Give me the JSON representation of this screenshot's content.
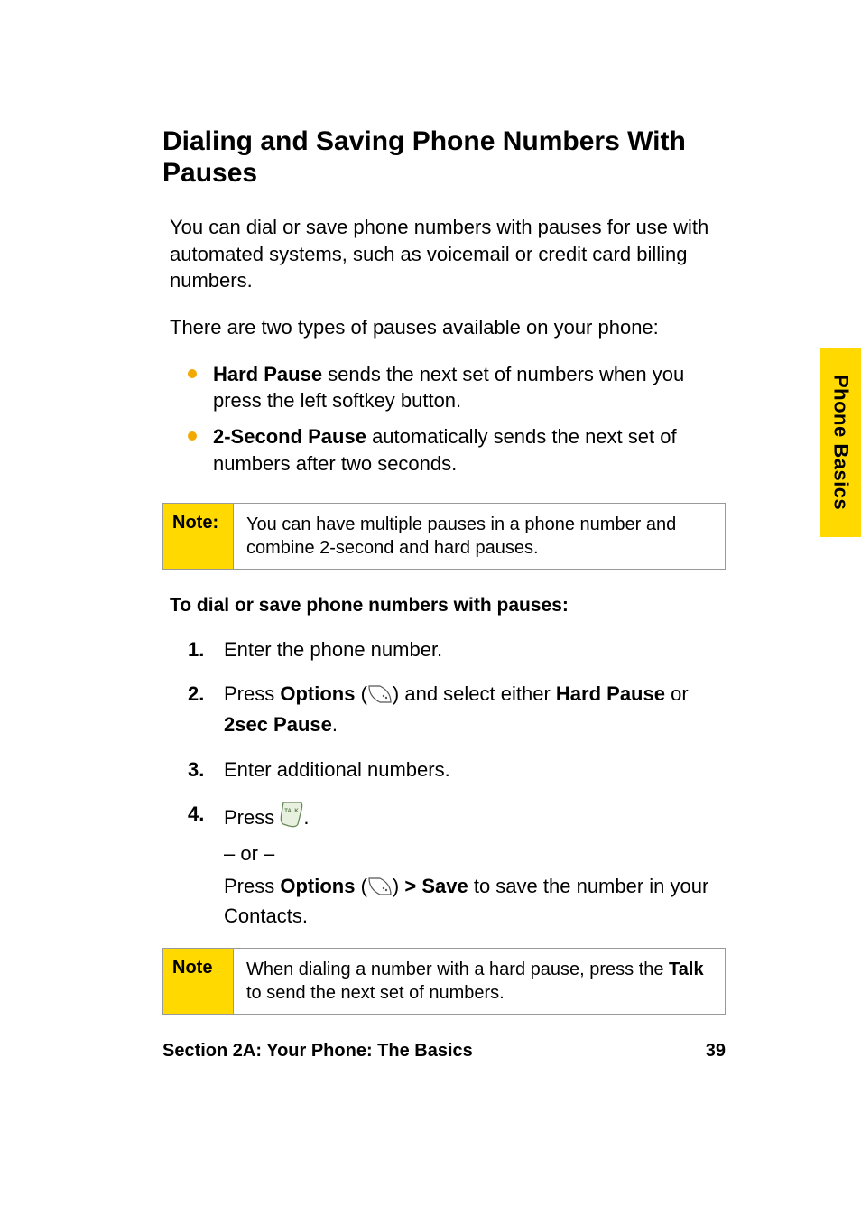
{
  "sideTab": "Phone Basics",
  "heading": "Dialing and Saving Phone Numbers With Pauses",
  "intro1": "You can dial or save phone numbers with pauses for use with automated systems, such as voicemail or credit card billing numbers.",
  "intro2": "There are two types of pauses available on your phone:",
  "bullets": [
    {
      "boldLead": "Hard Pause",
      "rest": " sends the next set of numbers when you press the left softkey button."
    },
    {
      "boldLead": "2-Second Pause",
      "rest": " automatically sends the next set of numbers after two seconds."
    }
  ],
  "note1": {
    "label": "Note:",
    "text": "You can have multiple pauses in a phone number and combine 2-second and hard pauses."
  },
  "subheading": "To dial or save phone numbers with pauses:",
  "steps": {
    "s1": {
      "num": "1.",
      "text": "Enter the phone number."
    },
    "s2": {
      "num": "2.",
      "pre": "Press ",
      "optionsWord": "Options",
      "open": " (",
      "close": ") and select either ",
      "hp": "Hard Pause",
      "or": " or ",
      "sp": "2sec Pause",
      "end": "."
    },
    "s3": {
      "num": "3.",
      "text": "Enter additional numbers."
    },
    "s4": {
      "num": "4.",
      "pressWord": "Press ",
      "period": ".",
      "orLine": "– or –",
      "press2": "Press ",
      "options2": "Options",
      "open2": " (",
      "close2": ") ",
      "gt": ">",
      "save": " Save",
      "tail": " to save the number in your Contacts."
    }
  },
  "note2": {
    "label": "Note",
    "pre": "When dialing a number with a hard pause, press the ",
    "talk": "Talk",
    "post": " to send the next set of numbers."
  },
  "footer": {
    "left": "Section 2A: Your Phone: The Basics",
    "right": "39"
  }
}
